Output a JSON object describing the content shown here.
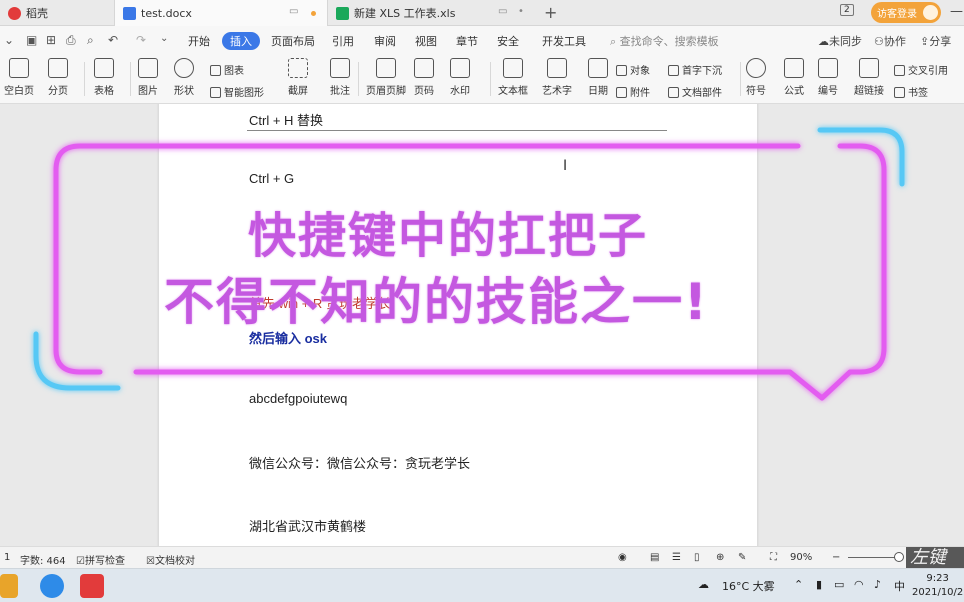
{
  "tabs": [
    {
      "label": "稻壳",
      "color": "#e23b3b"
    },
    {
      "label": "test.docx",
      "color": "#3b78e7"
    },
    {
      "label": "新建 XLS 工作表.xls",
      "color": "#1aa85a"
    }
  ],
  "titlebar": {
    "tab_count": "2",
    "guest_login": "访客登录",
    "new_tab": "+"
  },
  "menu": {
    "items": [
      "开始",
      "插入",
      "页面布局",
      "引用",
      "审阅",
      "视图",
      "章节",
      "安全",
      "开发工具"
    ],
    "active": "插入",
    "search_placeholder": "查找命令、搜索模板",
    "right": [
      "未同步",
      "协作",
      "分享"
    ]
  },
  "ribbon": {
    "big": [
      "空白页",
      "分页",
      "表格",
      "图片",
      "形状",
      "截屏",
      "批注",
      "页眉页脚",
      "页码",
      "水印",
      "文本框",
      "艺术字",
      "日期",
      "符号",
      "公式",
      "编号",
      "超链接"
    ],
    "small": {
      "chart": "图表",
      "smart_graphic": "智能图形",
      "object": "对象",
      "attachment": "附件",
      "drop_cap": "首字下沉",
      "doc_parts": "文档部件",
      "cross_ref": "交叉引用",
      "bookmark": "书签"
    }
  },
  "document": {
    "lines": [
      "Ctrl + H 替换",
      "Ctrl + G",
      "首先 win + R 贪玩老学长",
      "然后输入 osk",
      "abcdefgpoiutewq",
      "微信公众号：微信公众号：贪玩老学长",
      "湖北省武汉市黄鹤楼"
    ]
  },
  "overlay": {
    "line1": "快捷键中的扛把子",
    "line2": "不得不知的的技能之一!",
    "text_color": "#c458e0",
    "frame_color": "#e35cf0",
    "accent_color": "#56c8f5"
  },
  "statusbar": {
    "page": "1",
    "word_count": "字数: 464",
    "spell_check": "拼写检查",
    "doc_proof": "文档校对",
    "zoom": "90%",
    "watermark": "左键"
  },
  "taskbar": {
    "weather": "16°C 大雾",
    "ime": "中",
    "time": "9:23",
    "date": "2021/10/2"
  }
}
